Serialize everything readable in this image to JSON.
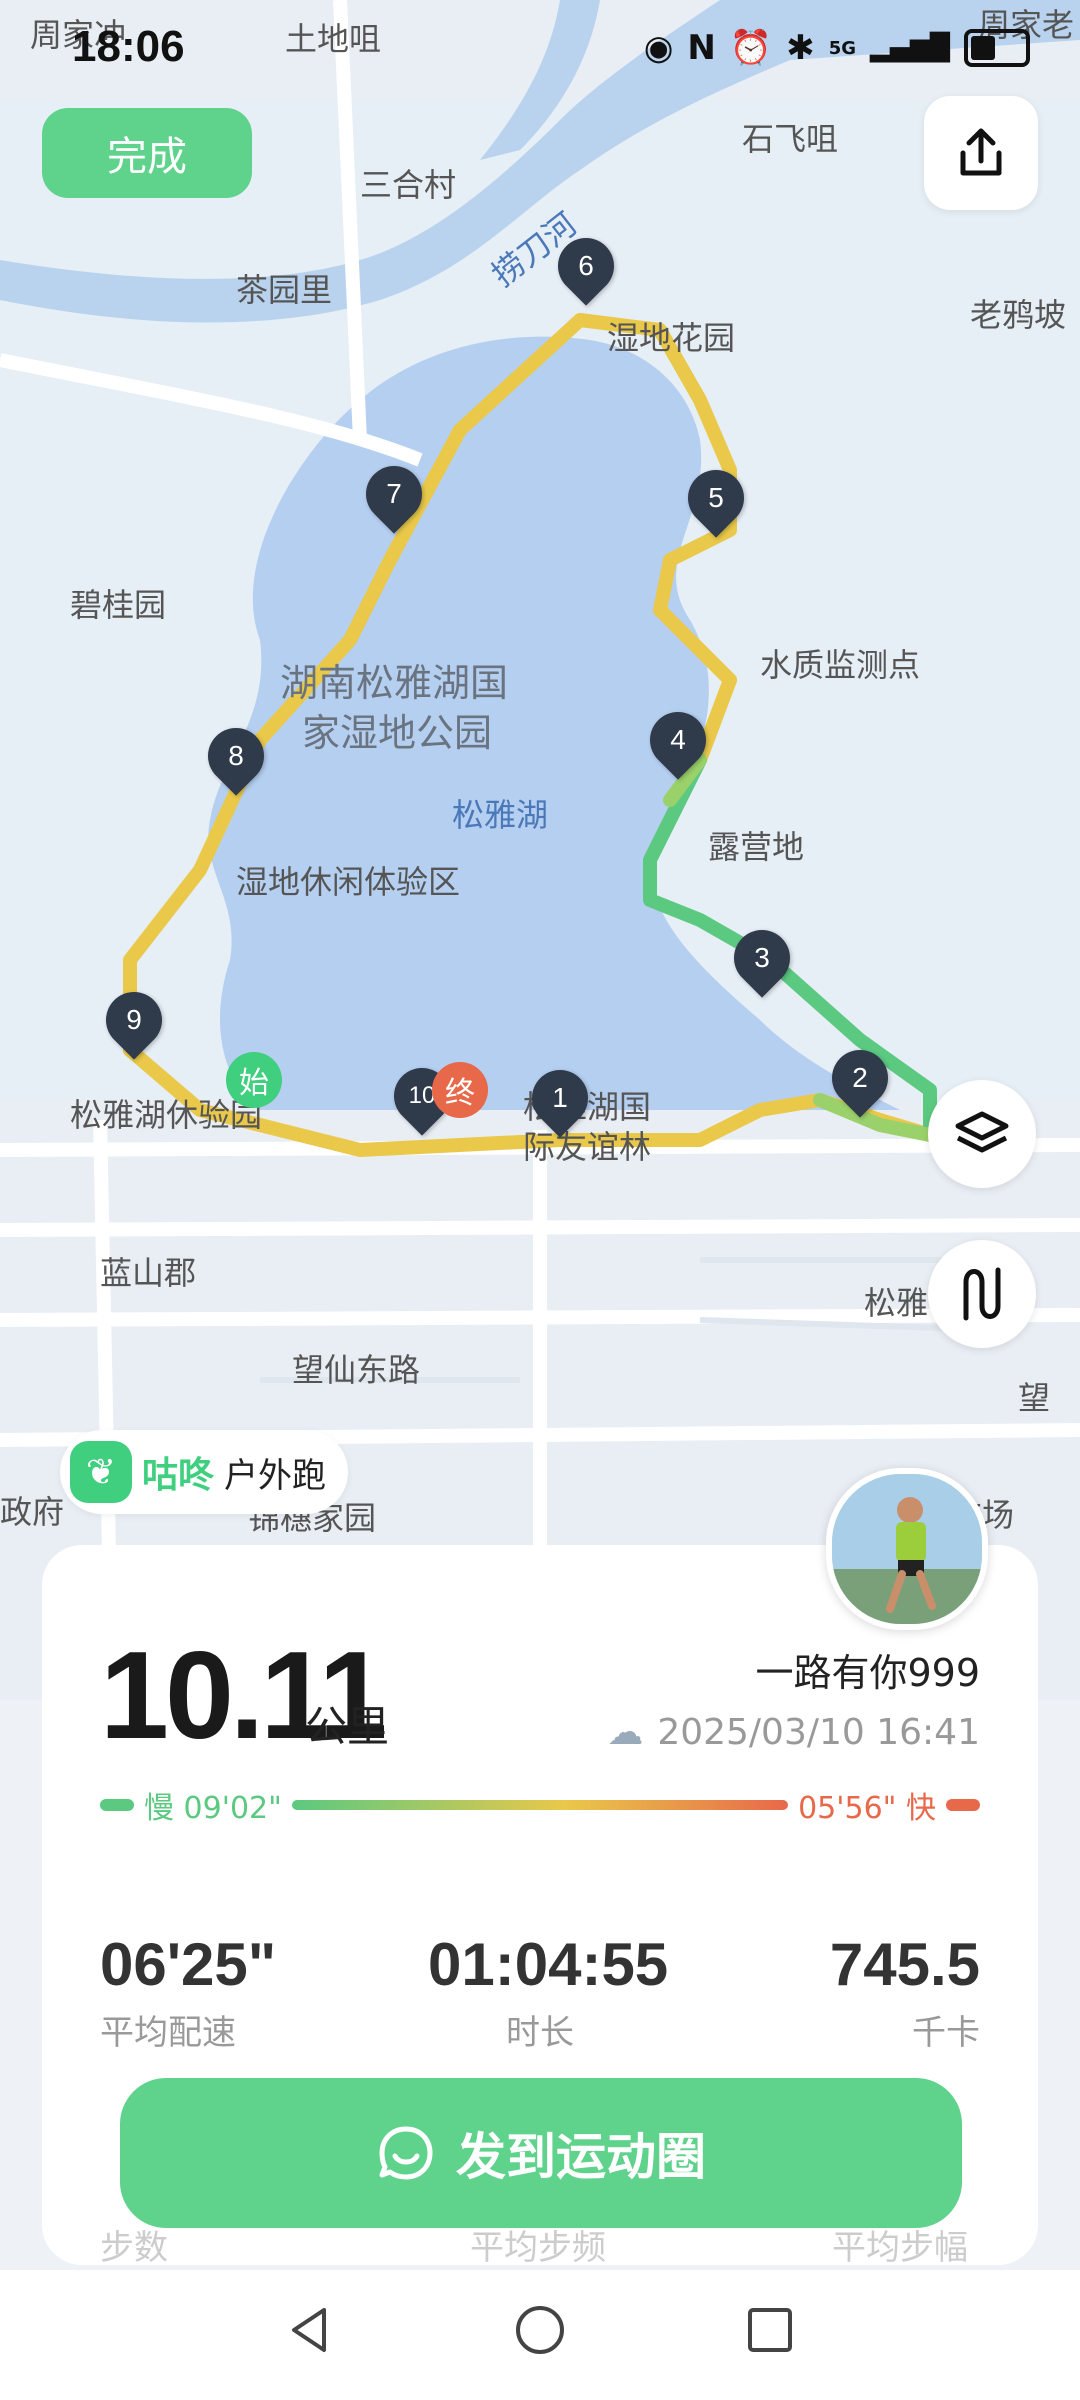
{
  "status_bar": {
    "time": "18:06",
    "network": "5G"
  },
  "toolbar": {
    "done_label": "完成"
  },
  "map": {
    "labels": {
      "zhoujiachong": "周家冲",
      "tudizui": "土地咀",
      "zhoujiaolao": "周家老",
      "shifeizui": "石飞咀",
      "sanhecun": "三合村",
      "laodaohe": "捞刀河",
      "chayuanli": "茶园里",
      "shidihuayuan": "湿地花园",
      "laoyapo": "老鸦坡",
      "biguiyuan": "碧桂园",
      "park_name_1": "湖南松雅湖国",
      "park_name_2": "家湿地公园",
      "shuizhi": "水质监测点",
      "songyahu": "松雅湖",
      "luyingdi": "露营地",
      "shidixiuxian": "湿地休闲体验区",
      "songyahu_tiyan": "松雅湖休验园",
      "guoji_1": "松雅湖国",
      "guoji_2": "际友谊林",
      "lanshanjun": "蓝山郡",
      "wangxian": "望仙东路",
      "songya_right": "松雅",
      "wang_right": "望",
      "zhengfu": "政府",
      "jinsui": "锦穗家园",
      "guangchang": "广场"
    },
    "start_marker": "始",
    "end_marker": "终",
    "km_markers": [
      "1",
      "2",
      "3",
      "4",
      "5",
      "6",
      "7",
      "8",
      "9",
      "10"
    ]
  },
  "brand": {
    "name": "咕咚",
    "activity": "户外跑"
  },
  "summary": {
    "distance": "10.11",
    "distance_unit": "公里",
    "user_name": "一路有你999",
    "datetime": "2025/03/10 16:41",
    "slow_label": "慢 09'02\"",
    "fast_label": "05'56\" 快"
  },
  "stats": [
    {
      "value": "06'25\"",
      "label": "平均配速"
    },
    {
      "value": "01:04:55",
      "label": "时长"
    },
    {
      "value": "745.5",
      "label": "千卡"
    }
  ],
  "stats_row2_labels": [
    "步数",
    "平均步频",
    "平均步幅"
  ],
  "post_button": {
    "label": "发到运动圈"
  },
  "colors": {
    "accent": "#5fd28c",
    "slow": "#5bc980",
    "fast": "#e8684a",
    "route_mid": "#e9c84a"
  }
}
